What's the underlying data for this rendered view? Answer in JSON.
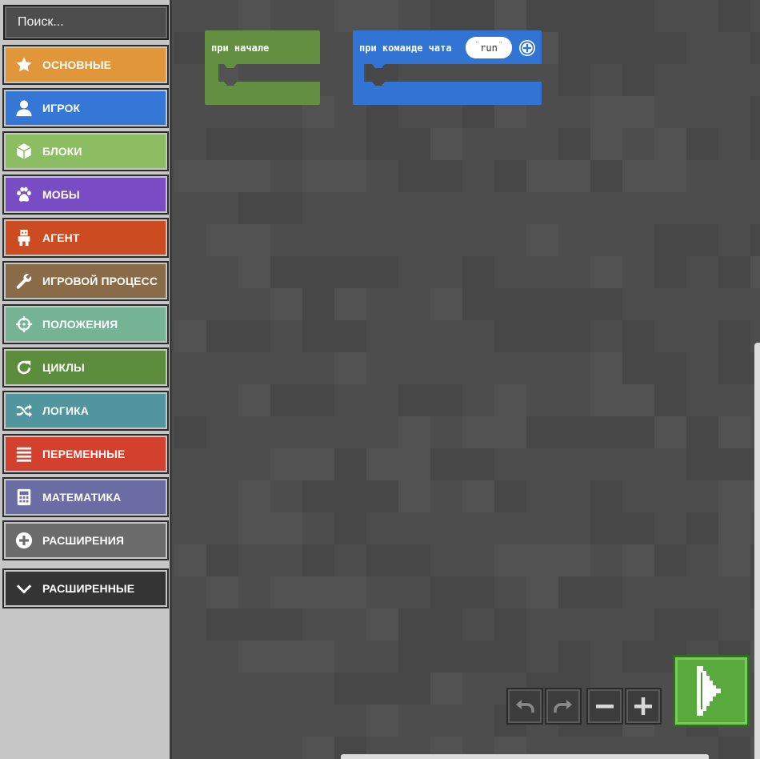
{
  "search": {
    "placeholder": "Поиск..."
  },
  "categories": [
    {
      "label": "ОСНОВНЫЕ",
      "icon": "star-icon",
      "color": "#e2963a"
    },
    {
      "label": "ИГРОК",
      "icon": "person-icon",
      "color": "#3477d6"
    },
    {
      "label": "БЛОКИ",
      "icon": "cube-icon",
      "color": "#8cbd63"
    },
    {
      "label": "МОБЫ",
      "icon": "paw-icon",
      "color": "#7a4cc4"
    },
    {
      "label": "АГЕНТ",
      "icon": "robot-icon",
      "color": "#cc4b21"
    },
    {
      "label": "ИГРОВОЙ ПРОЦЕСС",
      "icon": "wrench-icon",
      "color": "#8a6b47"
    },
    {
      "label": "ПОЛОЖЕНИЯ",
      "icon": "crosshair-icon",
      "color": "#74b394"
    },
    {
      "label": "ЦИКЛЫ",
      "icon": "loop-icon",
      "color": "#5c8d3c"
    },
    {
      "label": "ЛОГИКА",
      "icon": "shuffle-icon",
      "color": "#51969e"
    },
    {
      "label": "ПЕРЕМЕННЫЕ",
      "icon": "list-icon",
      "color": "#d4402e"
    },
    {
      "label": "МАТЕМАТИКА",
      "icon": "calculator-icon",
      "color": "#6a6ca3"
    },
    {
      "label": "РАСШИРЕНИЯ",
      "icon": "plus-circle-icon",
      "color": "#6b6b6b"
    }
  ],
  "advanced": {
    "label": "РАСШИРЕННЫЕ",
    "icon": "chevron-down-icon",
    "color": "#343434"
  },
  "blocks": {
    "on_start": {
      "label": "при начале",
      "color": "#629040"
    },
    "on_chat": {
      "label": "при команде чата",
      "arg": "run",
      "color": "#3274d4"
    }
  },
  "controls": {
    "undo": "undo-icon",
    "redo": "redo-icon",
    "zoom_out": "minus-icon",
    "zoom_in": "plus-icon",
    "run": "play-icon"
  }
}
